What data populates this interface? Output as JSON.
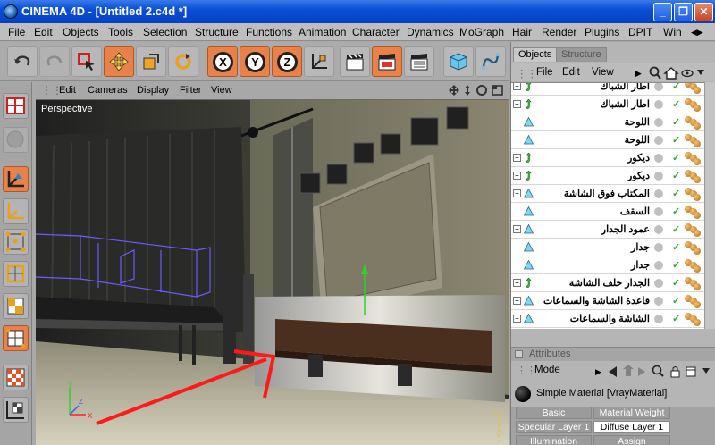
{
  "window": {
    "title": "CINEMA 4D - [Untitled 2.c4d *]",
    "minimize": "_",
    "restore": "❐",
    "close": "✕"
  },
  "menubar": {
    "items": [
      "File",
      "Edit",
      "Objects",
      "Tools",
      "Selection",
      "Structure",
      "Functions",
      "Animation",
      "Character",
      "Dynamics",
      "MoGraph",
      "Hair",
      "Render",
      "Plugins",
      "DPIT",
      "Win"
    ],
    "more": "◀▶"
  },
  "toolbar": {
    "axes": [
      "X",
      "Y",
      "Z"
    ]
  },
  "viewport": {
    "menu": [
      "Edit",
      "Cameras",
      "Display",
      "Filter",
      "View"
    ],
    "label": "Perspective",
    "nav_icons": [
      "move-icon",
      "zoom-icon",
      "rotate-icon",
      "maximize-icon"
    ]
  },
  "right_panel": {
    "tabs": [
      "Objects",
      "Structure"
    ],
    "menu": [
      "File",
      "Edit",
      "View"
    ],
    "objects": [
      {
        "name": "اطار الشباك",
        "icon": "green",
        "expand": "+"
      },
      {
        "name": "اطار الشباك",
        "icon": "green",
        "expand": "+"
      },
      {
        "name": "اللوحة",
        "icon": "cyan",
        "expand": ""
      },
      {
        "name": "اللوحة",
        "icon": "cyan",
        "expand": ""
      },
      {
        "name": "ديكور",
        "icon": "green",
        "expand": "+"
      },
      {
        "name": "ديكور",
        "icon": "green",
        "expand": "+"
      },
      {
        "name": "المكتاب فوق الشاشة",
        "icon": "cyan",
        "expand": "+"
      },
      {
        "name": "السقف",
        "icon": "cyan",
        "expand": ""
      },
      {
        "name": "عمود الجدار",
        "icon": "cyan",
        "expand": "+"
      },
      {
        "name": "جدار",
        "icon": "cyan",
        "expand": ""
      },
      {
        "name": "جدار",
        "icon": "cyan",
        "expand": ""
      },
      {
        "name": "الجدار خلف الشاشة",
        "icon": "green",
        "expand": "+"
      },
      {
        "name": "قاعدة الشاشة والسماعات",
        "icon": "cyan",
        "expand": "+"
      },
      {
        "name": "الشاشة والسماعات",
        "icon": "cyan",
        "expand": "+"
      }
    ],
    "check_mark": "✓",
    "attributes_label": "Attributes",
    "mode_label": "Mode",
    "material_name": "Simple Material [VrayMaterial]",
    "material_tabs": [
      [
        "Basic",
        "Material Weight"
      ],
      [
        "Specular Layer 1",
        "Diffuse Layer 1"
      ],
      [
        "Illumination",
        "Assign"
      ]
    ],
    "material_selected_tab": "Diffuse Layer 1"
  },
  "colors": {
    "titlebar": "#0a4fd6",
    "accent_orange": "#e9824a",
    "annotation_arrow": "#ff1a1a",
    "axis_y": "#2fd12f"
  }
}
